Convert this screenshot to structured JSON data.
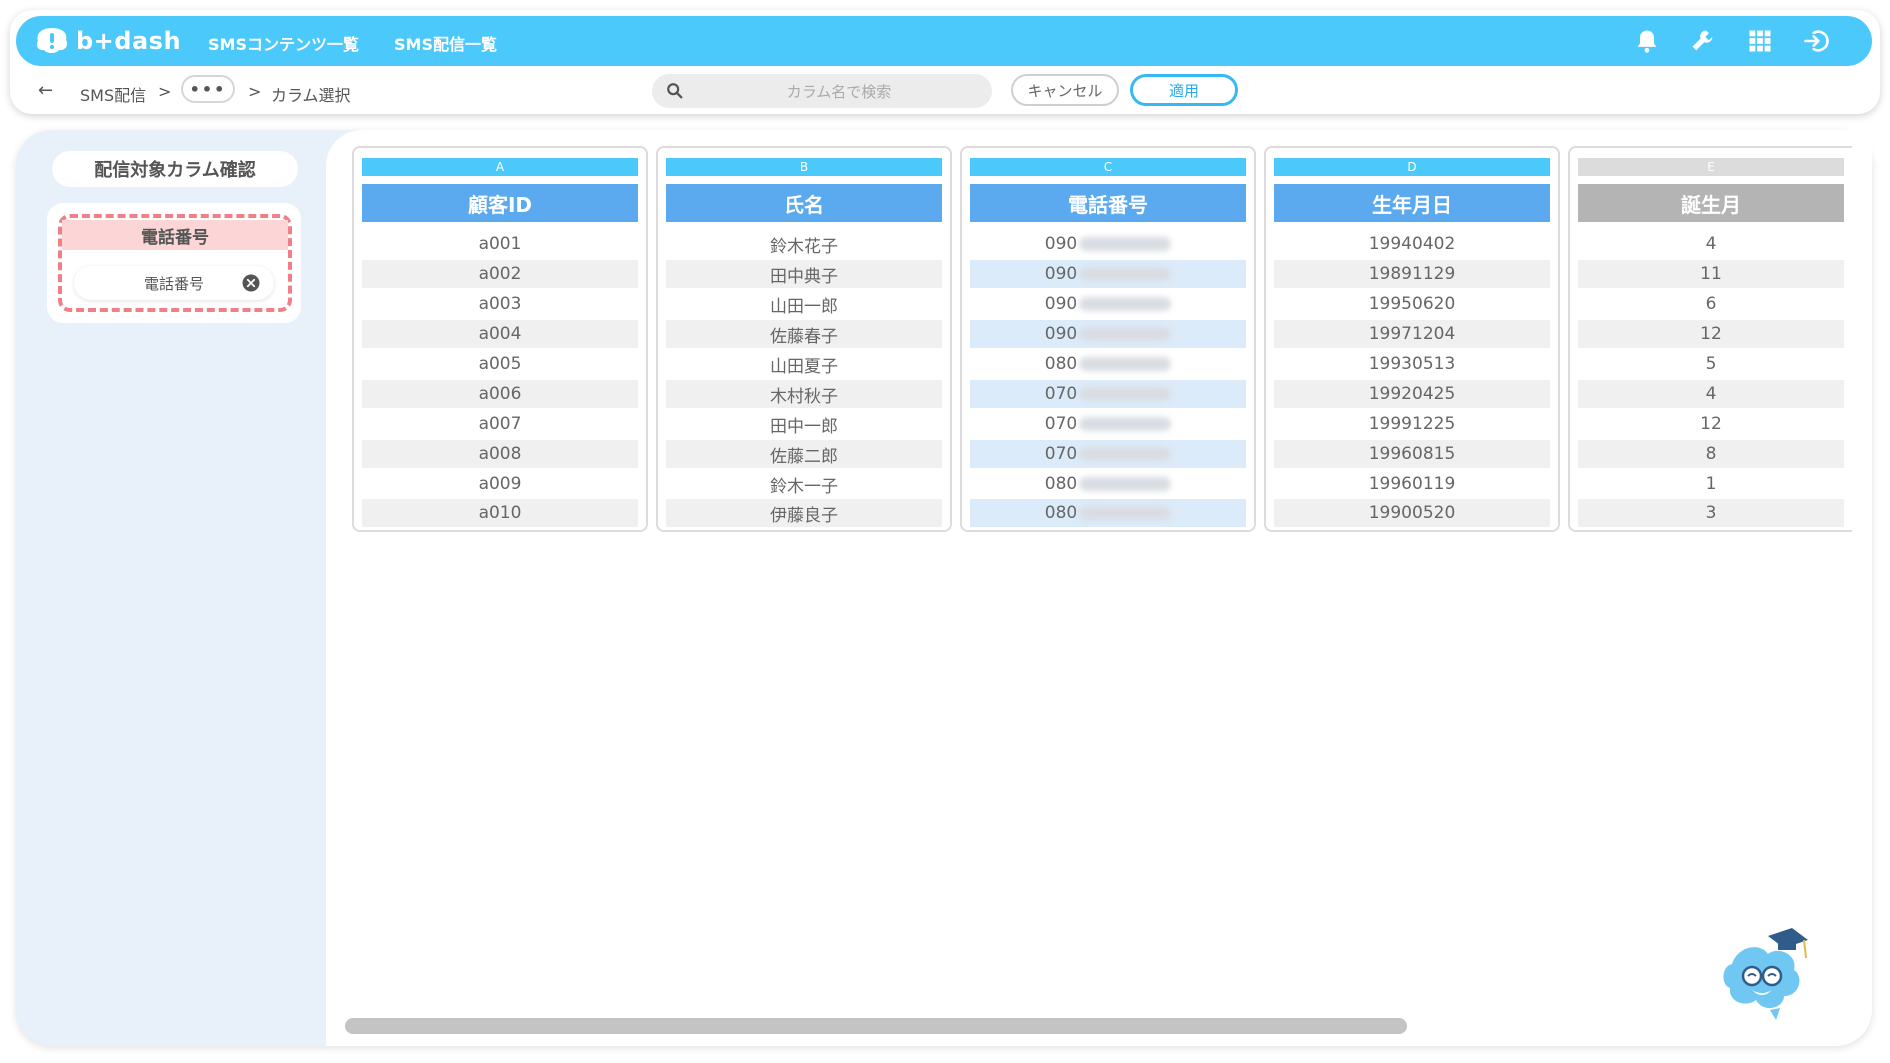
{
  "app": {
    "logo_text": "b+dash",
    "nav": [
      "SMSコンテンツ一覧",
      "SMS配信一覧"
    ],
    "icons": [
      "bell-icon",
      "wrench-icon",
      "grid-icon",
      "logout-icon"
    ]
  },
  "breadcrumb": {
    "back": "←",
    "first": "SMS配信",
    "sep1": ">",
    "ellipsis": "•••",
    "sep2": ">",
    "current": "カラム選択"
  },
  "toolbar": {
    "search_placeholder": "カラム名で検索",
    "cancel_label": "キャンセル",
    "apply_label": "適用"
  },
  "side_panel": {
    "title": "配信対象カラム確認",
    "group_label": "電話番号",
    "selected_item": "電話番号"
  },
  "columns": [
    {
      "letter": "A",
      "header": "顧客ID",
      "values": [
        "a001",
        "a002",
        "a003",
        "a004",
        "a005",
        "a006",
        "a007",
        "a008",
        "a009",
        "a010"
      ]
    },
    {
      "letter": "B",
      "header": "氏名",
      "values": [
        "鈴木花子",
        "田中典子",
        "山田一郎",
        "佐藤春子",
        "山田夏子",
        "木村秋子",
        "田中一郎",
        "佐藤二郎",
        "鈴木一子",
        "伊藤良子"
      ]
    },
    {
      "letter": "C",
      "header": "電話番号",
      "values": [
        "090",
        "090",
        "090",
        "090",
        "080",
        "070",
        "070",
        "070",
        "080",
        "080"
      ]
    },
    {
      "letter": "D",
      "header": "生年月日",
      "values": [
        "19940402",
        "19891129",
        "19950620",
        "19971204",
        "19930513",
        "19920425",
        "19991225",
        "19960815",
        "19960119",
        "19900520"
      ]
    },
    {
      "letter": "E",
      "header": "誕生月",
      "values": [
        "4",
        "11",
        "6",
        "12",
        "5",
        "4",
        "12",
        "8",
        "1",
        "3"
      ]
    }
  ],
  "colors": {
    "header_bar": "#4cc9fb",
    "column_header": "#5ba9ee",
    "selected_border": "#f07f86",
    "apply_border": "#36b8f5"
  }
}
